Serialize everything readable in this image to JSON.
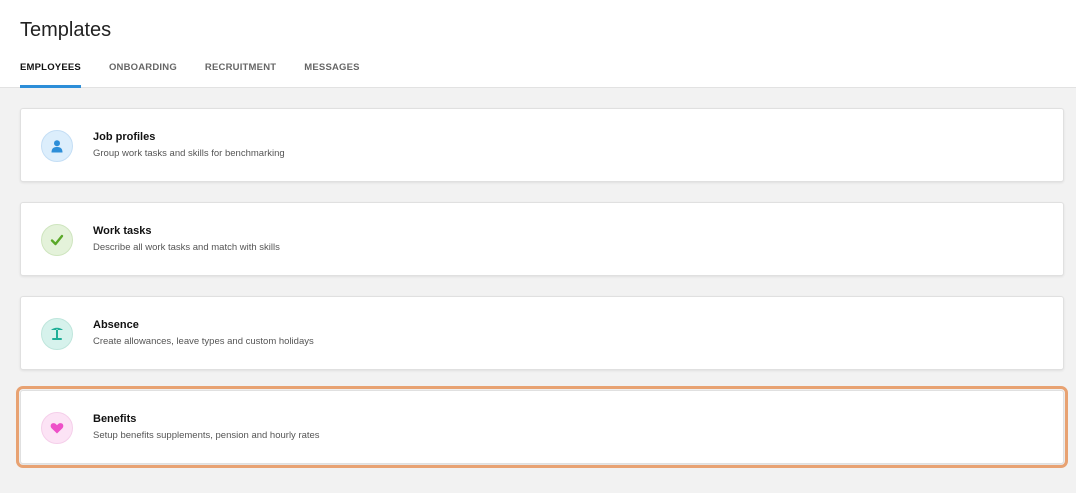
{
  "header": {
    "title": "Templates",
    "tabs": [
      {
        "label": "EMPLOYEES",
        "active": true
      },
      {
        "label": "ONBOARDING",
        "active": false
      },
      {
        "label": "RECRUITMENT",
        "active": false
      },
      {
        "label": "MESSAGES",
        "active": false
      }
    ]
  },
  "cards": [
    {
      "title": "Job profiles",
      "description": "Group work tasks and skills for benchmarking",
      "icon": "person-icon",
      "icon_bg": "#dceefc",
      "icon_color": "#2d8ed8"
    },
    {
      "title": "Work tasks",
      "description": "Describe all work tasks and match with skills",
      "icon": "checkmark-icon",
      "icon_bg": "#e4f2da",
      "icon_color": "#5aa829"
    },
    {
      "title": "Absence",
      "description": "Create allowances, leave types and custom holidays",
      "icon": "palm-tree-icon",
      "icon_bg": "#d6f2ec",
      "icon_color": "#1fae97"
    },
    {
      "title": "Benefits",
      "description": "Setup benefits supplements, pension and hourly rates",
      "icon": "heart-icon",
      "icon_bg": "#fce3f5",
      "icon_color": "#ee4fc8"
    }
  ],
  "highlight_color": "#e8a272"
}
